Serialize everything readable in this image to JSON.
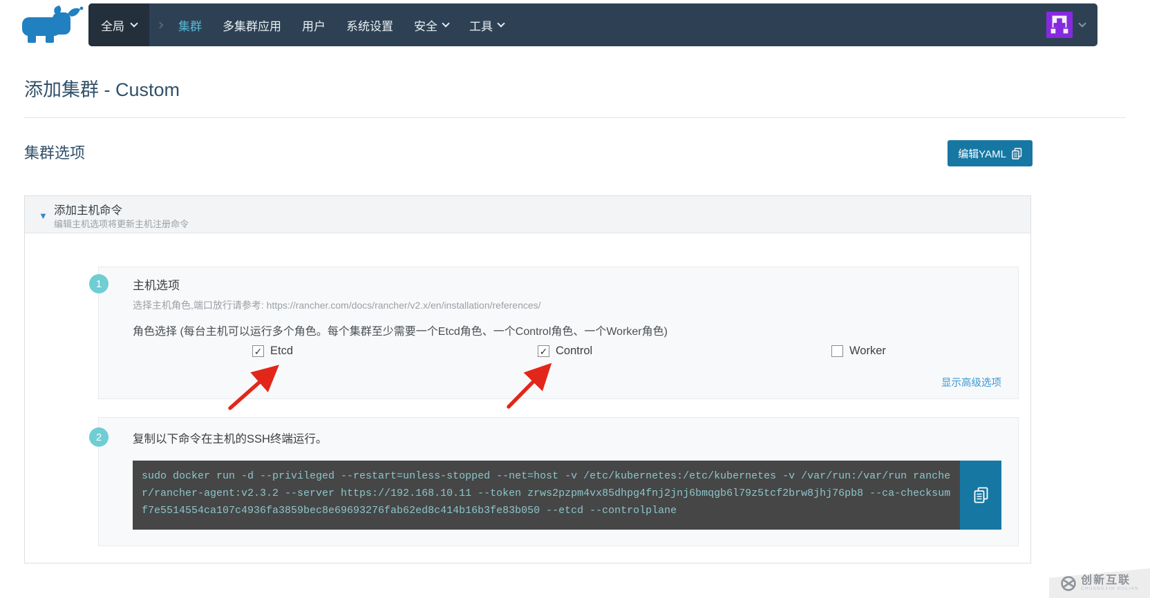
{
  "nav": {
    "items": [
      {
        "label": "全局",
        "has_dropdown": true
      },
      {
        "label": "集群",
        "active": true
      },
      {
        "label": "多集群应用"
      },
      {
        "label": "用户"
      },
      {
        "label": "系统设置"
      },
      {
        "label": "安全",
        "has_dropdown": true
      },
      {
        "label": "工具",
        "has_dropdown": true
      }
    ]
  },
  "page": {
    "title": "添加集群 - Custom"
  },
  "cluster_options": {
    "heading": "集群选项",
    "edit_yaml_label": "编辑YAML"
  },
  "add_host_panel": {
    "title": "添加主机命令",
    "subtitle": "编辑主机选项将更新主机注册命令",
    "step1": {
      "number": "1",
      "title": "主机选项",
      "hint": "选择主机角色,端口放行请参考: https://rancher.com/docs/rancher/v2.x/en/installation/references/",
      "role_label": "角色选择 (每台主机可以运行多个角色。每个集群至少需要一个Etcd角色、一个Control角色、一个Worker角色)",
      "roles": [
        {
          "label": "Etcd",
          "checked": true
        },
        {
          "label": "Control",
          "checked": true
        },
        {
          "label": "Worker",
          "checked": false
        }
      ],
      "advanced_link": "显示高级选项"
    },
    "step2": {
      "number": "2",
      "title": "复制以下命令在主机的SSH终端运行。",
      "command": "sudo docker run -d --privileged --restart=unless-stopped --net=host -v /etc/kubernetes:/etc/kubernetes -v /var/run:/var/run rancher/rancher-agent:v2.3.2 --server https://192.168.10.11 --token zrws2pzpm4vx85dhpg4fnj2jnj6bmqgb6l79z5tcf2brw8jhj76pb8 --ca-checksum f7e5514554ca107c4936fa3859bec8e69693276fab62ed8c414b16b3fe83b050 --etcd --controlplane"
    }
  },
  "watermark": {
    "name": "创新互联",
    "subtext": "CHUANGXIN HULIAN"
  },
  "icons": {
    "logo": "rancher-cow-logo",
    "dropdowns": "chevron-down-icon",
    "collapse": "caret-down-icon",
    "yaml_button": "clipboard-icon",
    "copy_button": "clipboard-icon",
    "watermark": "circle-x-icon",
    "annotations": "red-arrow"
  },
  "colors": {
    "nav_bg": "#2e4154",
    "nav_scope_bg": "#232f3b",
    "nav_active_item": "#57b9d5",
    "accent_button": "#1777a3",
    "step_circle": "#6fcdd4",
    "code_bg": "#464646",
    "code_text": "#8cc6cb",
    "arrow_red": "#e2271a",
    "avatar_purple": "#8629e0",
    "link_blue": "#3d98d3"
  }
}
